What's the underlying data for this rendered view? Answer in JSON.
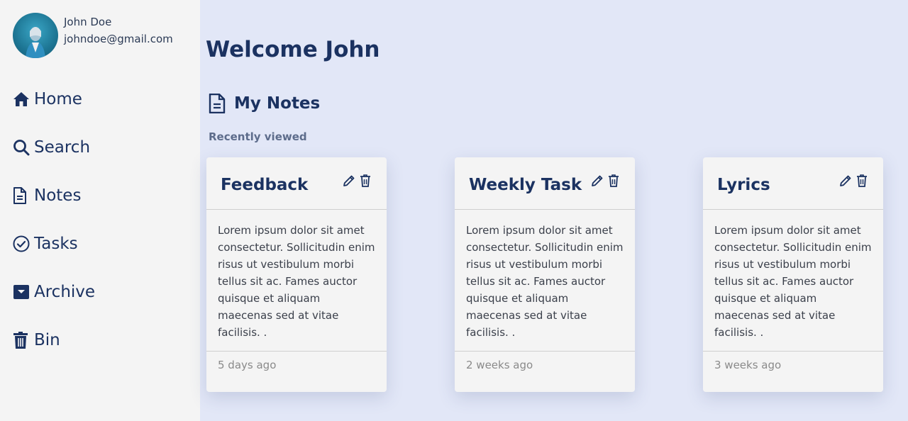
{
  "user": {
    "name": "John Doe",
    "email": "johndoe@gmail.com"
  },
  "nav": [
    {
      "label": "Home",
      "icon": "home-icon"
    },
    {
      "label": "Search",
      "icon": "search-icon"
    },
    {
      "label": "Notes",
      "icon": "note-icon"
    },
    {
      "label": "Tasks",
      "icon": "check-circle-icon"
    },
    {
      "label": "Archive",
      "icon": "archive-icon"
    },
    {
      "label": "Bin",
      "icon": "trash-icon"
    }
  ],
  "main": {
    "welcome": "Welcome John",
    "section_title": "My Notes",
    "recent_label": "Recently viewed"
  },
  "cards": [
    {
      "title": "Feedback",
      "body": "Lorem ipsum dolor sit amet consectetur. Sollicitudin enim risus ut vestibulum morbi tellus sit ac. Fames auctor quisque et aliquam maecenas sed at vitae facilisis. .",
      "time": "5 days ago"
    },
    {
      "title": "Weekly Task",
      "body": "Lorem ipsum dolor sit amet consectetur. Sollicitudin enim risus ut vestibulum morbi tellus sit ac. Fames auctor quisque et aliquam maecenas sed at vitae facilisis. .",
      "time": "2 weeks ago"
    },
    {
      "title": "Lyrics",
      "body": "Lorem ipsum dolor sit amet consectetur. Sollicitudin enim risus ut vestibulum morbi tellus sit ac. Fames auctor quisque et aliquam maecenas sed at vitae facilisis. .",
      "time": "3 weeks ago"
    }
  ],
  "colors": {
    "primary": "#1b3261",
    "sidebar_bg": "#f4f4f4",
    "main_bg": "#e2e7f7",
    "muted": "#8a8a8a"
  }
}
